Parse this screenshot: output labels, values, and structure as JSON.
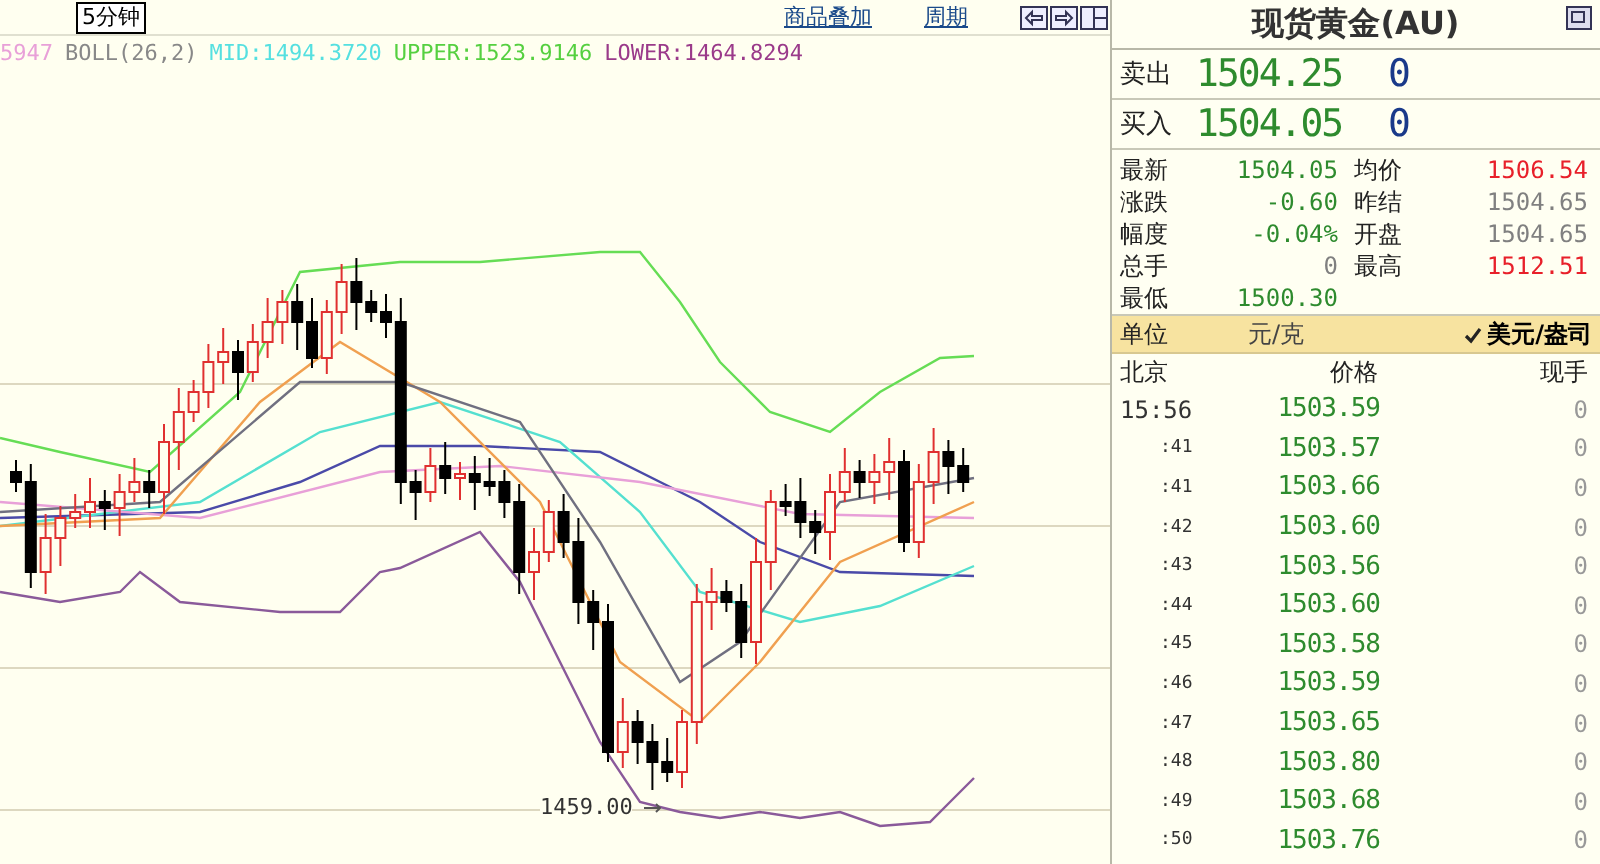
{
  "toolbar": {
    "period": "5分钟",
    "links": [
      "商品叠加",
      "周期"
    ]
  },
  "indicator": {
    "cut_value": "5947",
    "name": "BOLL(26,2)",
    "mid": "MID:1494.3720",
    "upper": "UPPER:1523.9146",
    "lower": "LOWER:1464.8294"
  },
  "chart": {
    "low_label": "1459.00"
  },
  "quote": {
    "title": "现货黄金(AU)",
    "bid_ask": [
      {
        "label": "卖出",
        "price": "1504.25",
        "volume": "0"
      },
      {
        "label": "买入",
        "price": "1504.05",
        "volume": "0"
      }
    ],
    "stats": [
      {
        "label": "最新",
        "value": "1504.05",
        "color": "#2e8b2e"
      },
      {
        "label": "均价",
        "value": "1506.54",
        "color": "#e8202a"
      },
      {
        "label": "涨跌",
        "value": "-0.60",
        "color": "#2e8b2e"
      },
      {
        "label": "昨结",
        "value": "1504.65",
        "color": "#808080"
      },
      {
        "label": "幅度",
        "value": "-0.04%",
        "color": "#2e8b2e"
      },
      {
        "label": "开盘",
        "value": "1504.65",
        "color": "#808080"
      },
      {
        "label": "总手",
        "value": "0",
        "color": "#808080"
      },
      {
        "label": "最高",
        "value": "1512.51",
        "color": "#e8202a"
      },
      {
        "label": "最低",
        "value": "1500.30",
        "color": "#2e8b2e"
      }
    ],
    "units": {
      "label": "单位",
      "options": [
        {
          "label": "元/克",
          "selected": false
        },
        {
          "label": "美元/盎司",
          "selected": true
        }
      ]
    },
    "ticks": {
      "columns": [
        "北京",
        "价格",
        "现手"
      ],
      "rows": [
        {
          "time": "15:56",
          "price": "1503.59",
          "volume": "0"
        },
        {
          "time": ":41",
          "price": "1503.57",
          "volume": "0"
        },
        {
          "time": ":41",
          "price": "1503.66",
          "volume": "0"
        },
        {
          "time": ":42",
          "price": "1503.60",
          "volume": "0"
        },
        {
          "time": ":43",
          "price": "1503.56",
          "volume": "0"
        },
        {
          "time": ":44",
          "price": "1503.60",
          "volume": "0"
        },
        {
          "time": ":45",
          "price": "1503.58",
          "volume": "0"
        },
        {
          "time": ":46",
          "price": "1503.59",
          "volume": "0"
        },
        {
          "time": ":47",
          "price": "1503.65",
          "volume": "0"
        },
        {
          "time": ":48",
          "price": "1503.80",
          "volume": "0"
        },
        {
          "time": ":49",
          "price": "1503.68",
          "volume": "0"
        },
        {
          "time": ":50",
          "price": "1503.76",
          "volume": "0"
        }
      ]
    }
  }
}
